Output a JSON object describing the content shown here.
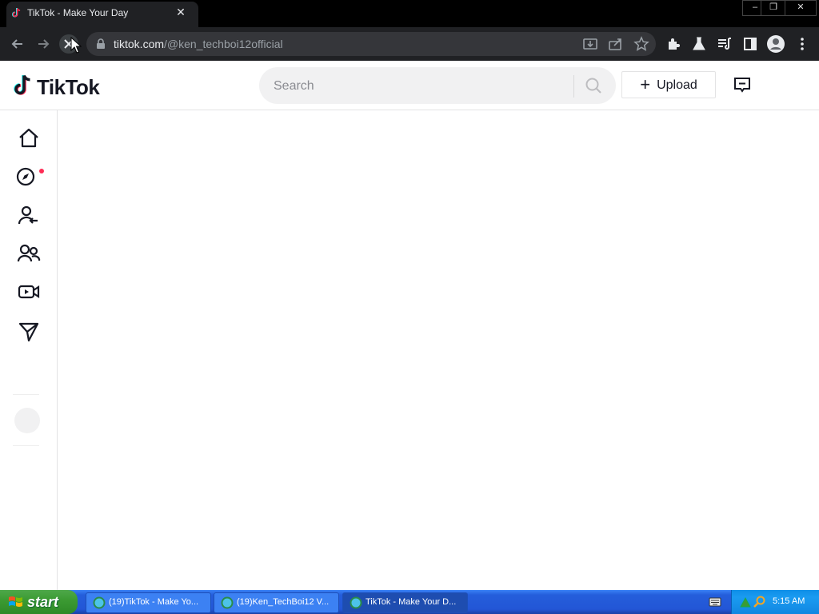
{
  "browser": {
    "tab_title": "TikTok - Make Your Day",
    "tab_close": "✕",
    "url_host": "tiktok.com",
    "url_path": "/@ken_techboi12official",
    "window_buttons": [
      "–",
      "❐",
      "✕"
    ]
  },
  "tiktok": {
    "logo": "TikTok",
    "search_placeholder": "Search",
    "upload_label": "Upload",
    "upload_plus": "+"
  },
  "taskbar": {
    "start_label": "start",
    "tasks": [
      {
        "label": "(19)TikTok - Make Yo..."
      },
      {
        "label": "(19)Ken_TechBoi12 V..."
      },
      {
        "label": "TikTok - Make Your D..."
      }
    ],
    "clock": "5:15 AM"
  },
  "colors": {
    "tiktok_red": "#fe2c55",
    "tiktok_cyan": "#25f4ee",
    "text_dark": "#161823"
  }
}
